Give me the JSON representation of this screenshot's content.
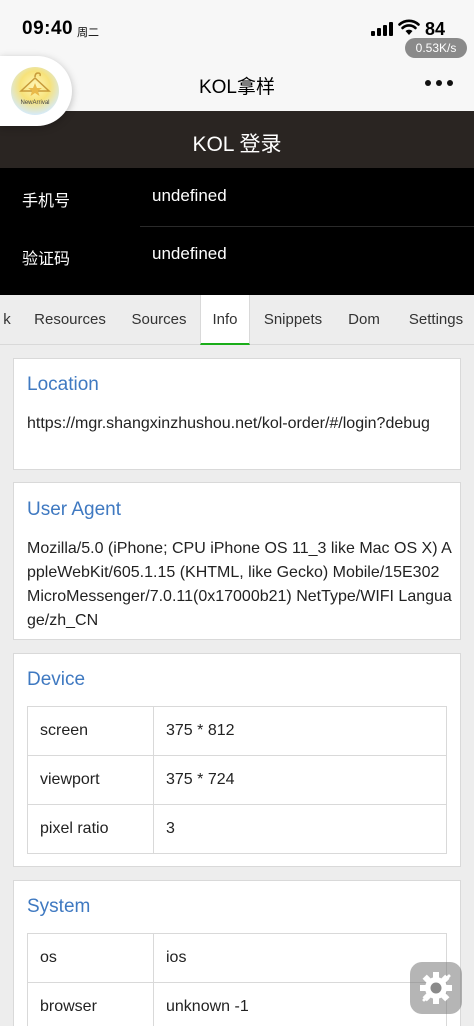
{
  "status_bar": {
    "time": "09:40",
    "weekday": "周二",
    "battery": "84",
    "speed": "0.53K/s"
  },
  "nav": {
    "title": "KOL拿样",
    "logo_text": "NewArrival"
  },
  "page": {
    "header_title": "KOL 登录",
    "fields": [
      {
        "label": "手机号",
        "value": "undefined"
      },
      {
        "label": "验证码",
        "value": "undefined"
      }
    ]
  },
  "console_tabs": {
    "items": [
      "k",
      "Resources",
      "Sources",
      "Info",
      "Snippets",
      "Dom",
      "Settings"
    ],
    "active": "Info"
  },
  "info": {
    "location": {
      "title": "Location",
      "url": "https://mgr.shangxinzhushou.net/kol-order/#/login?debug"
    },
    "user_agent": {
      "title": "User Agent",
      "value": "Mozilla/5.0 (iPhone; CPU iPhone OS 11_3 like Mac OS X) AppleWebKit/605.1.15 (KHTML, like Gecko) Mobile/15E302 MicroMessenger/7.0.11(0x17000b21) NetType/WIFI Language/zh_CN"
    },
    "device": {
      "title": "Device",
      "rows": [
        {
          "key": "screen",
          "value": "375 * 812"
        },
        {
          "key": "viewport",
          "value": "375 * 724"
        },
        {
          "key": "pixel ratio",
          "value": "3"
        }
      ]
    },
    "system": {
      "title": "System",
      "rows": [
        {
          "key": "os",
          "value": "ios"
        },
        {
          "key": "browser",
          "value": "unknown -1"
        }
      ]
    }
  },
  "colors": {
    "accent_blue": "#3f79c1",
    "active_tab_indicator": "#1aad19",
    "header_dark": "#2a2522"
  }
}
